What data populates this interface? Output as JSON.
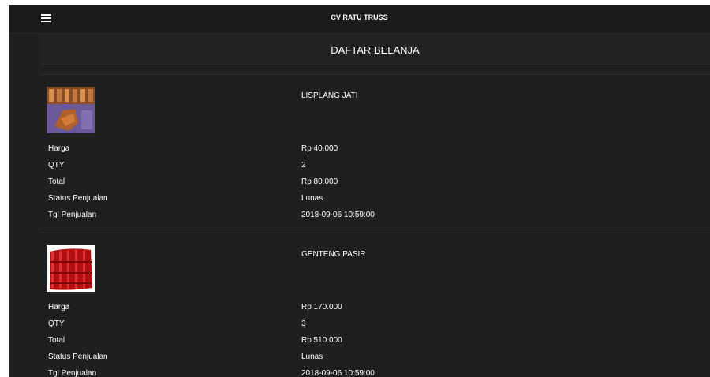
{
  "header": {
    "app_title": "CV RATU TRUSS",
    "menu_icon": "hamburger-menu-icon"
  },
  "page": {
    "title": "DAFTAR BELANJA"
  },
  "labels": {
    "harga": "Harga",
    "qty": "QTY",
    "total": "Total",
    "status": "Status Penjualan",
    "tgl": "Tgl Penjualan"
  },
  "items": [
    {
      "name": "LISPLANG JATI",
      "harga": "Rp 40.000",
      "qty": "2",
      "total": "Rp 80.000",
      "status": "Lunas",
      "tgl": "2018-09-06 10:59:00"
    },
    {
      "name": "GENTENG PASIR",
      "harga": "Rp 170.000",
      "qty": "3",
      "total": "Rp 510.000",
      "status": "Lunas",
      "tgl": "2018-09-06 10:59:00"
    }
  ],
  "colors": {
    "background": "#1f1f1f",
    "text": "#ffffff"
  }
}
